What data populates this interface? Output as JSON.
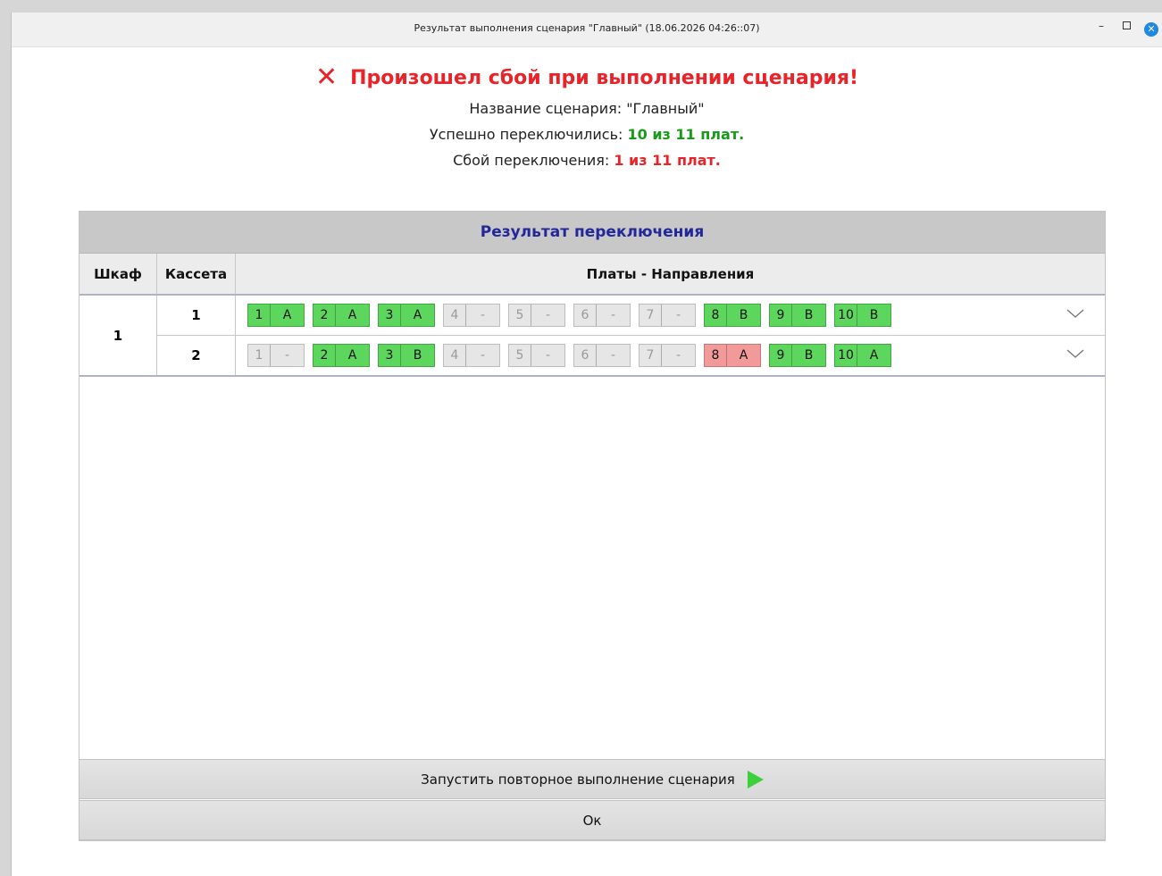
{
  "window": {
    "title": "Результат выполнения сценария \"Главный\" (18.06.2026 04:26::07)",
    "min_glyph": "–",
    "close_glyph": "✕"
  },
  "header": {
    "error_icon": "✕",
    "error_title": "Произошел сбой при выполнении сценария!",
    "scenario_line": "Название сценария: \"Главный\"",
    "success_label": "Успешно переключились:",
    "success_value": "10 из 11 плат.",
    "fail_label": "Сбой переключения:",
    "fail_value": "1 из 11 плат."
  },
  "table": {
    "title": "Результат переключения",
    "columns": [
      "Шкаф",
      "Кассета",
      "Платы - Направления"
    ],
    "cabinet": "1",
    "rows": [
      {
        "cassette": "1",
        "boards": [
          {
            "num": "1",
            "dir": "A",
            "status": "ok"
          },
          {
            "num": "2",
            "dir": "A",
            "status": "ok"
          },
          {
            "num": "3",
            "dir": "A",
            "status": "ok"
          },
          {
            "num": "4",
            "dir": "-",
            "status": "off"
          },
          {
            "num": "5",
            "dir": "-",
            "status": "off"
          },
          {
            "num": "6",
            "dir": "-",
            "status": "off"
          },
          {
            "num": "7",
            "dir": "-",
            "status": "off"
          },
          {
            "num": "8",
            "dir": "B",
            "status": "ok"
          },
          {
            "num": "9",
            "dir": "B",
            "status": "ok"
          },
          {
            "num": "10",
            "dir": "B",
            "status": "ok"
          }
        ]
      },
      {
        "cassette": "2",
        "boards": [
          {
            "num": "1",
            "dir": "-",
            "status": "off"
          },
          {
            "num": "2",
            "dir": "A",
            "status": "ok"
          },
          {
            "num": "3",
            "dir": "B",
            "status": "ok"
          },
          {
            "num": "4",
            "dir": "-",
            "status": "off"
          },
          {
            "num": "5",
            "dir": "-",
            "status": "off"
          },
          {
            "num": "6",
            "dir": "-",
            "status": "off"
          },
          {
            "num": "7",
            "dir": "-",
            "status": "off"
          },
          {
            "num": "8",
            "dir": "A",
            "status": "error"
          },
          {
            "num": "9",
            "dir": "B",
            "status": "ok"
          },
          {
            "num": "10",
            "dir": "A",
            "status": "ok"
          }
        ]
      }
    ]
  },
  "buttons": {
    "retry_label": "Запустить повторное выполнение сценария",
    "ok_label": "Ок"
  },
  "colors": {
    "error": "#e8242a",
    "success": "#1a9a1a",
    "table_title": "#22289a",
    "board_ok": "#5cd65c",
    "board_off": "#e6e6e6",
    "board_error": "#f29a9a"
  }
}
